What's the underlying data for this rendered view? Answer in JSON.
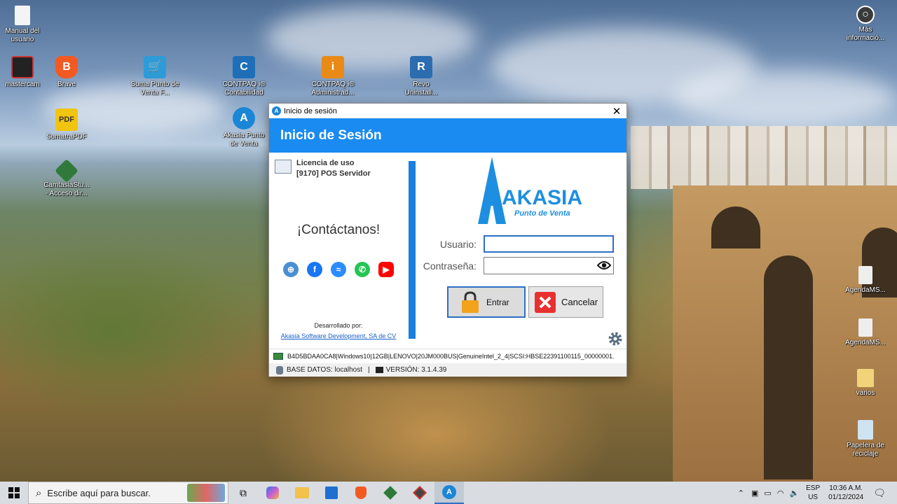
{
  "desktop": {
    "icons_left": [
      {
        "label": "Manual del usuario",
        "icon": "document-icon"
      },
      {
        "label": "mastercam",
        "icon": "mastercam-icon"
      },
      {
        "label": "Brave",
        "icon": "brave-icon"
      },
      {
        "label": "Suma Punto de Venta F...",
        "icon": "cart-shield-icon"
      },
      {
        "label": "CONTPAQ i® Contabilidad",
        "icon": "contpaq-icon"
      },
      {
        "label": "CONTPAQ i® Administrad...",
        "icon": "contpaq-admin-icon"
      },
      {
        "label": "Revo Uninstall...",
        "icon": "revo-icon"
      },
      {
        "label": "SumatraPDF",
        "icon": "pdf-icon"
      },
      {
        "label": "Akasia Punto de Venta",
        "icon": "akasia-icon"
      },
      {
        "label": "CamtasiaStu... - Acceso dir...",
        "icon": "camtasia-icon"
      }
    ],
    "icons_right": [
      {
        "label": "Más informació...",
        "icon": "info-icon"
      },
      {
        "label": "AgendaMS...",
        "icon": "file-icon"
      },
      {
        "label": "AgendaMS...",
        "icon": "file-icon"
      },
      {
        "label": "varios",
        "icon": "folder-icon"
      },
      {
        "label": "Papelera de reciclaje",
        "icon": "recycle-bin-icon"
      }
    ]
  },
  "window": {
    "title": "Inicio de sesión",
    "header": "Inicio de Sesión",
    "license_line1": "Licencia de uso",
    "license_line2": "[9170] POS Servidor",
    "contact": "¡Contáctanos!",
    "social_icons": [
      "globe-icon",
      "facebook-icon",
      "messenger-icon",
      "whatsapp-icon",
      "youtube-icon"
    ],
    "developed_by": "Desarrollado por:",
    "developer_link": "Akasia Software Development, SA de CV",
    "logo_name": "AKASIA",
    "logo_tagline": "Punto de Venta",
    "user_label": "Usuario:",
    "user_value": "",
    "password_label": "Contraseña:",
    "password_value": "",
    "enter_button": "Entrar",
    "cancel_button": "Cancelar",
    "hardware_info": "B4D5BDAA0CA8|Windows10|12GB|LENOVO|20JM000BUS|GenuineIntel_2_4|SCSI:HBSE22391100115_00000001.",
    "db_status": "BASE DATOS: localhost",
    "separator": "|",
    "version": "VERSIÓN: 3.1.4.39",
    "accent": "#1a8bf0"
  },
  "taskbar": {
    "search_placeholder": "Escribe aquí para buscar.",
    "lang_top": "ESP",
    "lang_bottom": "US",
    "time": "10:36 A.M.",
    "date": "01/12/2024"
  }
}
